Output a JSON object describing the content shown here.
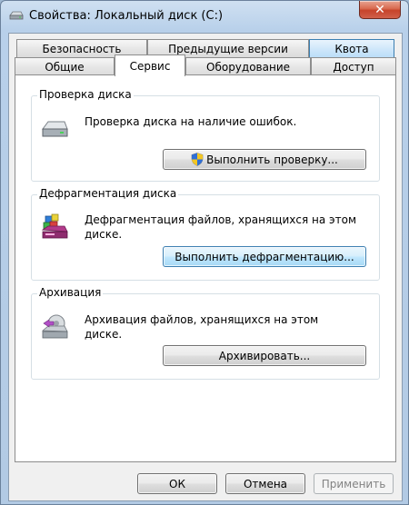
{
  "window": {
    "title": "Свойства: Локальный диск (C:)",
    "close_glyph": "✕"
  },
  "tabs": {
    "row1": [
      "Безопасность",
      "Предыдущие версии",
      "Квота"
    ],
    "row2": [
      "Общие",
      "Сервис",
      "Оборудование",
      "Доступ"
    ],
    "active": "Сервис"
  },
  "check": {
    "title": "Проверка диска",
    "description": "Проверка диска на наличие ошибок.",
    "button_label": "Выполнить проверку..."
  },
  "defrag": {
    "title": "Дефрагментация диска",
    "description": "Дефрагментация файлов, хранящихся на этом диске.",
    "button_label": "Выполнить дефрагментацию..."
  },
  "backup": {
    "title": "Архивация",
    "description": "Архивация файлов, хранящихся на этом диске.",
    "button_label": "Архивировать..."
  },
  "footer": {
    "ok_label": "ОК",
    "cancel_label": "Отмена",
    "apply_label": "Применить"
  }
}
